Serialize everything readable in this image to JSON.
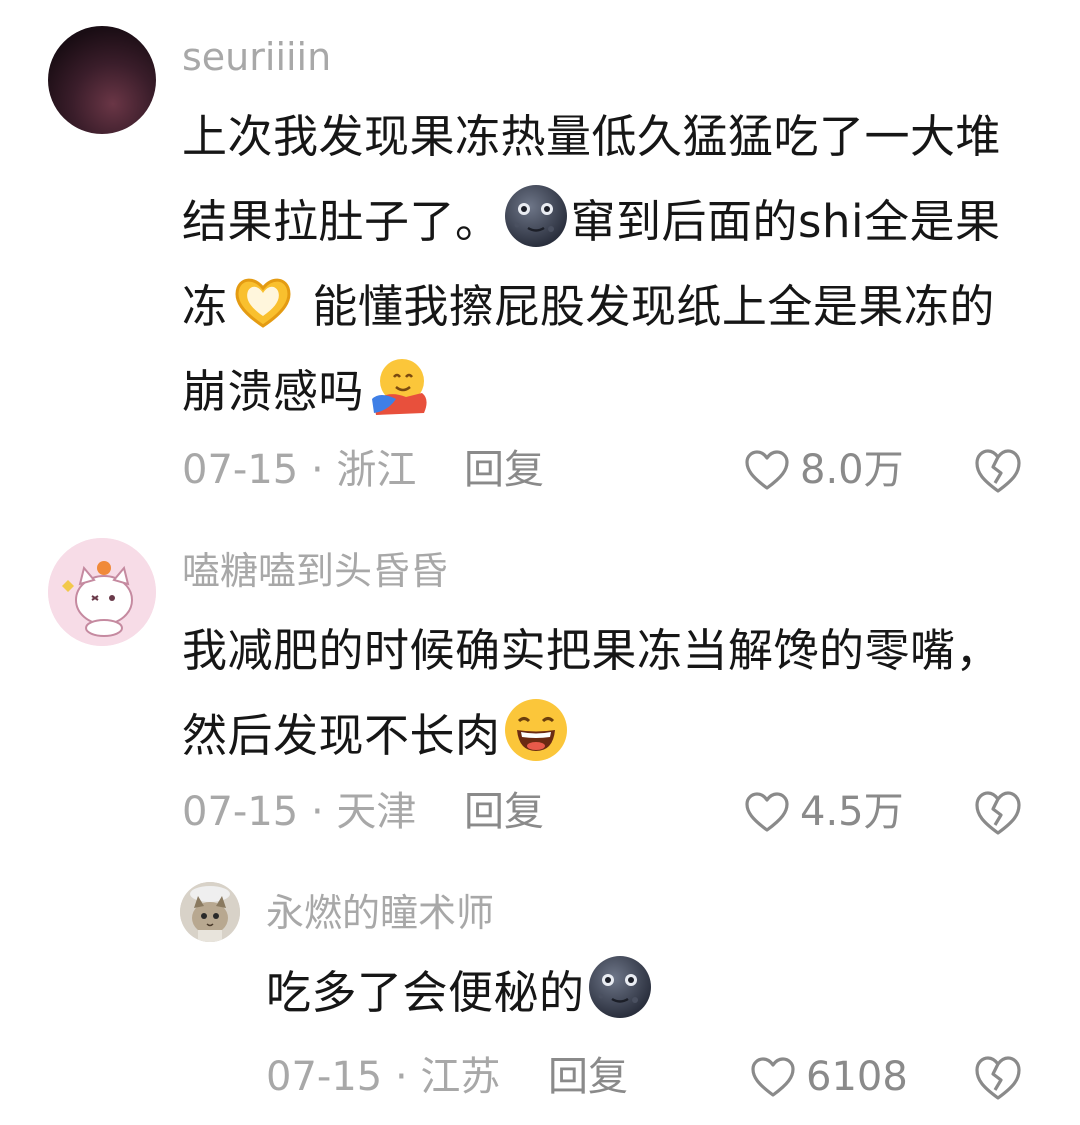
{
  "comments": [
    {
      "username": "seuriiiin",
      "text": {
        "p1": "上次我发现果冻热量低久猛猛吃了一大堆 结果拉肚子了。",
        "p2": "窜到后面的shi全是果冻",
        "p3": " 能懂我擦屁股发现纸上全是果冻的崩溃感吗"
      },
      "emojis": [
        "moon-face-icon",
        "heart-hands-icon",
        "hugging-face-icon"
      ],
      "date_location": "07-15 · 浙江",
      "reply_label": "回复",
      "likes": "8.0万"
    },
    {
      "username": "嗑糖嗑到头昏昏",
      "text": {
        "p1": "我减肥的时候确实把果冻当解馋的零嘴，然后发现不长肉"
      },
      "emojis": [
        "grinning-face-icon"
      ],
      "date_location": "07-15 · 天津",
      "reply_label": "回复",
      "likes": "4.5万"
    },
    {
      "username": "永燃的瞳术师",
      "text": {
        "p1": "吃多了会便秘的"
      },
      "emojis": [
        "moon-face-icon"
      ],
      "date_location": "07-15 · 江苏",
      "reply_label": "回复",
      "likes": "6108"
    }
  ],
  "colors": {
    "meta_text": "#a8a8a8",
    "body_text": "#161616",
    "icon_stroke": "#8a8a8a"
  }
}
